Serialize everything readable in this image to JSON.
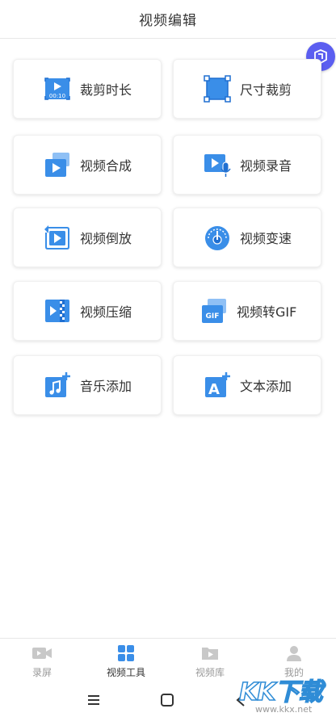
{
  "header": {
    "title": "视频编辑"
  },
  "tools": [
    {
      "label": "裁剪时长",
      "icon": "clip-duration-icon",
      "badge": "00:10"
    },
    {
      "label": "尺寸裁剪",
      "icon": "size-crop-icon"
    },
    {
      "label": "视频合成",
      "icon": "video-merge-icon"
    },
    {
      "label": "视频录音",
      "icon": "video-record-audio-icon"
    },
    {
      "label": "视频倒放",
      "icon": "video-reverse-icon"
    },
    {
      "label": "视频变速",
      "icon": "video-speed-icon"
    },
    {
      "label": "视频压缩",
      "icon": "video-compress-icon"
    },
    {
      "label": "视频转GIF",
      "icon": "video-to-gif-icon",
      "badge": "GIF"
    },
    {
      "label": "音乐添加",
      "icon": "music-add-icon"
    },
    {
      "label": "文本添加",
      "icon": "text-add-icon",
      "badge": "A"
    }
  ],
  "tabbar": {
    "items": [
      {
        "label": "录屏",
        "icon": "screen-record-icon",
        "active": false
      },
      {
        "label": "视频工具",
        "icon": "video-tools-icon",
        "active": true
      },
      {
        "label": "视频库",
        "icon": "video-library-icon",
        "active": false
      },
      {
        "label": "我的",
        "icon": "profile-icon",
        "active": false
      }
    ]
  },
  "watermark": {
    "brand": "KK下载",
    "url": "www.kkx.net"
  },
  "colors": {
    "accent": "#3a8ee8",
    "accent_dark": "#1f6fd1",
    "badge": "#5b5ef0",
    "text": "#333333",
    "muted": "#999999"
  }
}
